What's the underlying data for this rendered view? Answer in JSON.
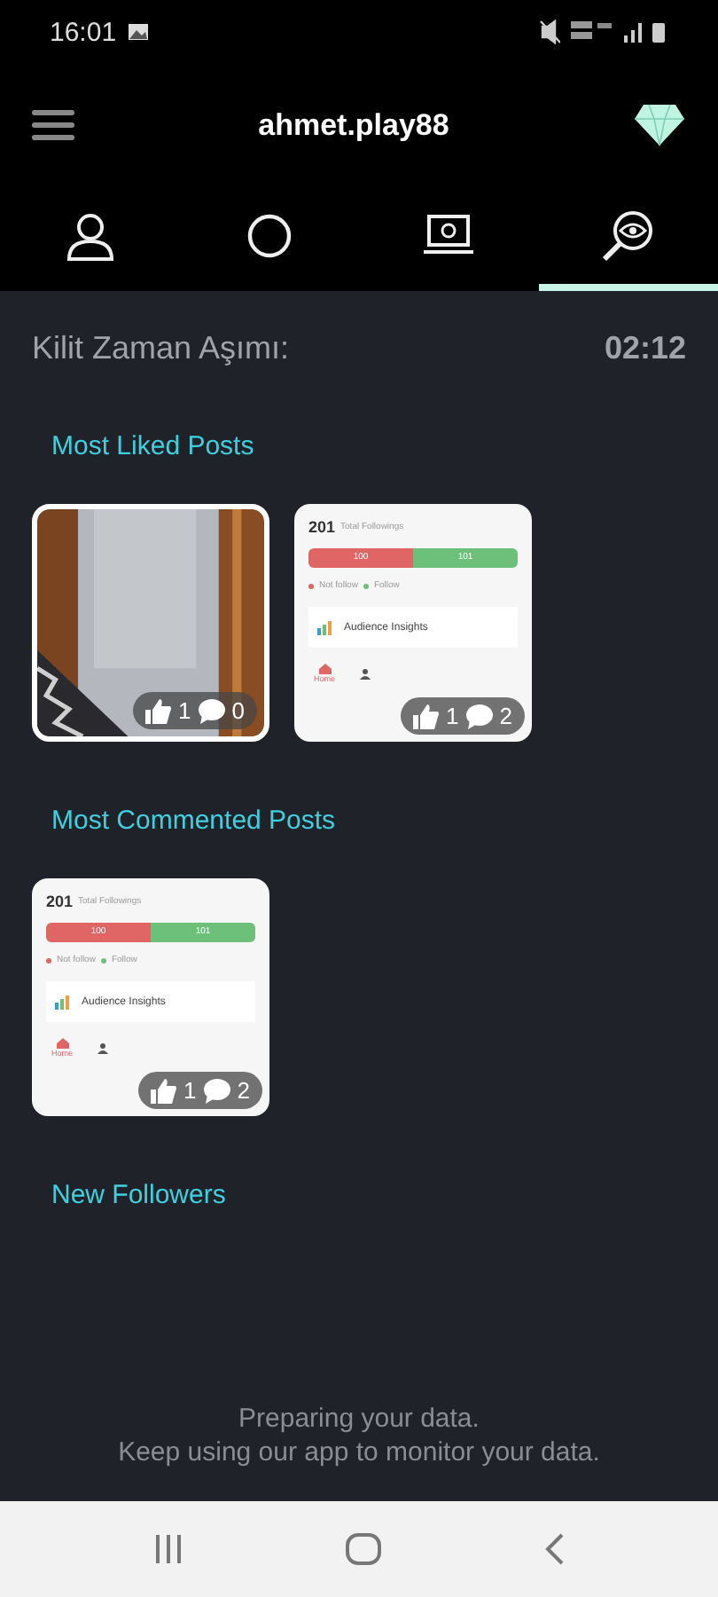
{
  "status_bar": {
    "time": "16:01"
  },
  "header": {
    "title": "ahmet.play88"
  },
  "tabs": [
    {
      "kind": "person",
      "selected": false
    },
    {
      "kind": "circle",
      "selected": false
    },
    {
      "kind": "laptop",
      "selected": false
    },
    {
      "kind": "eye-search",
      "selected": true
    }
  ],
  "lock": {
    "label": "Kilit Zaman Aşımı:",
    "value": "02:12"
  },
  "sections": [
    {
      "title": "Most Liked Posts",
      "posts": [
        {
          "kind": "picture",
          "likes": "1",
          "comments": "0"
        },
        {
          "kind": "screenshot",
          "likes": "1",
          "comments": "2",
          "screen": {
            "total": "201",
            "total_label": "Total Followings",
            "bar": [
              {
                "label": "100",
                "color": "#e06666"
              },
              {
                "label": "101",
                "color": "#6cc07a"
              }
            ],
            "legend": [
              {
                "label": "Not follow",
                "color": "#e06666"
              },
              {
                "label": "Follow",
                "color": "#6cc07a"
              }
            ],
            "insight": "Audience Insights",
            "nav": [
              "Home"
            ]
          }
        }
      ]
    },
    {
      "title": "Most Commented Posts",
      "posts": [
        {
          "kind": "screenshot",
          "likes": "1",
          "comments": "2",
          "screen": {
            "total": "201",
            "total_label": "Total Followings",
            "bar": [
              {
                "label": "100",
                "color": "#e06666"
              },
              {
                "label": "101",
                "color": "#6cc07a"
              }
            ],
            "legend": [
              {
                "label": "Not follow",
                "color": "#e06666"
              },
              {
                "label": "Follow",
                "color": "#6cc07a"
              }
            ],
            "insight": "Audience Insights",
            "nav": [
              "Home"
            ]
          }
        }
      ]
    },
    {
      "title": "New Followers"
    }
  ],
  "message": [
    "Preparing your data.",
    "Keep using our app to monitor your data."
  ]
}
